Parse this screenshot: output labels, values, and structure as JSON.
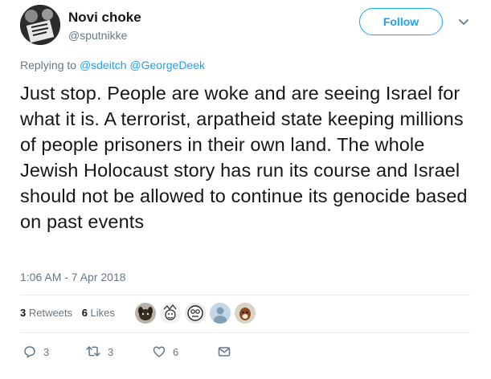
{
  "user": {
    "display_name": "Novi choke",
    "handle": "@sputnikke"
  },
  "follow": {
    "label": "Follow"
  },
  "reply": {
    "prefix": "Replying to",
    "mentions": [
      "@sdeitch",
      "@GeorgeDeek"
    ]
  },
  "tweet": {
    "text": "Just stop. People are woke and are seeing Israel for what it is. A terrorist, arpatheid state keeping millions of people prisoners in their own land. The whole Jewish Holocaust story has run its course and Israel should not be allowed to continue its genocide based on past events",
    "timestamp": "1:06 AM - 7 Apr 2018"
  },
  "stats": {
    "retweets_count": "3",
    "retweets_label": "Retweets",
    "likes_count": "6",
    "likes_label": "Likes"
  },
  "likers": [
    {
      "icon": "avatar-dog"
    },
    {
      "icon": "avatar-cartoon"
    },
    {
      "icon": "avatar-sketch-face"
    },
    {
      "icon": "avatar-default"
    },
    {
      "icon": "avatar-dog-brown"
    }
  ],
  "actions": {
    "reply_count": "3",
    "retweet_count": "3",
    "like_count": "6"
  },
  "colors": {
    "accent": "#1da1f2",
    "muted": "#657786",
    "text": "#14171a",
    "divider": "#e6ecf0"
  }
}
